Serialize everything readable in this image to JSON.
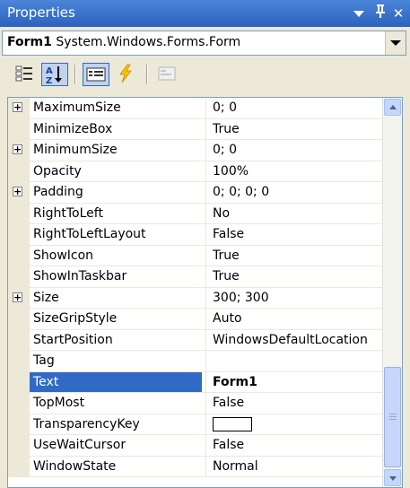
{
  "panel": {
    "title": "Properties",
    "pin_glyph": "ᵾ",
    "close_glyph": "✕"
  },
  "selector": {
    "object_name": "Form1",
    "object_type": "System.Windows.Forms.Form"
  },
  "toolbar": {
    "buttons": [
      {
        "name": "categorized-icon",
        "pressed": false
      },
      {
        "name": "alphabetical-icon",
        "pressed": true
      },
      {
        "name": "properties-icon",
        "pressed": true
      },
      {
        "name": "events-icon",
        "pressed": false
      },
      {
        "name": "property-pages-icon",
        "pressed": false
      }
    ]
  },
  "properties": [
    {
      "name": "MaximumSize",
      "value": "0; 0",
      "expandable": true
    },
    {
      "name": "MinimizeBox",
      "value": "True",
      "expandable": false
    },
    {
      "name": "MinimumSize",
      "value": "0; 0",
      "expandable": true
    },
    {
      "name": "Opacity",
      "value": "100%",
      "expandable": false
    },
    {
      "name": "Padding",
      "value": "0; 0; 0; 0",
      "expandable": true
    },
    {
      "name": "RightToLeft",
      "value": "No",
      "expandable": false
    },
    {
      "name": "RightToLeftLayout",
      "value": "False",
      "expandable": false
    },
    {
      "name": "ShowIcon",
      "value": "True",
      "expandable": false
    },
    {
      "name": "ShowInTaskbar",
      "value": "True",
      "expandable": false
    },
    {
      "name": "Size",
      "value": "300; 300",
      "expandable": true
    },
    {
      "name": "SizeGripStyle",
      "value": "Auto",
      "expandable": false
    },
    {
      "name": "StartPosition",
      "value": "WindowsDefaultLocation",
      "expandable": false
    },
    {
      "name": "Tag",
      "value": "",
      "expandable": false
    },
    {
      "name": "Text",
      "value": "Form1",
      "expandable": false,
      "selected": true
    },
    {
      "name": "TopMost",
      "value": "False",
      "expandable": false
    },
    {
      "name": "TransparencyKey",
      "value": "",
      "expandable": false,
      "color_swatch": "#ffffff"
    },
    {
      "name": "UseWaitCursor",
      "value": "False",
      "expandable": false
    },
    {
      "name": "WindowState",
      "value": "Normal",
      "expandable": false
    }
  ],
  "colors": {
    "title_bar": "#2c62be",
    "selection": "#316ac5",
    "panel_bg": "#ece9d8"
  }
}
